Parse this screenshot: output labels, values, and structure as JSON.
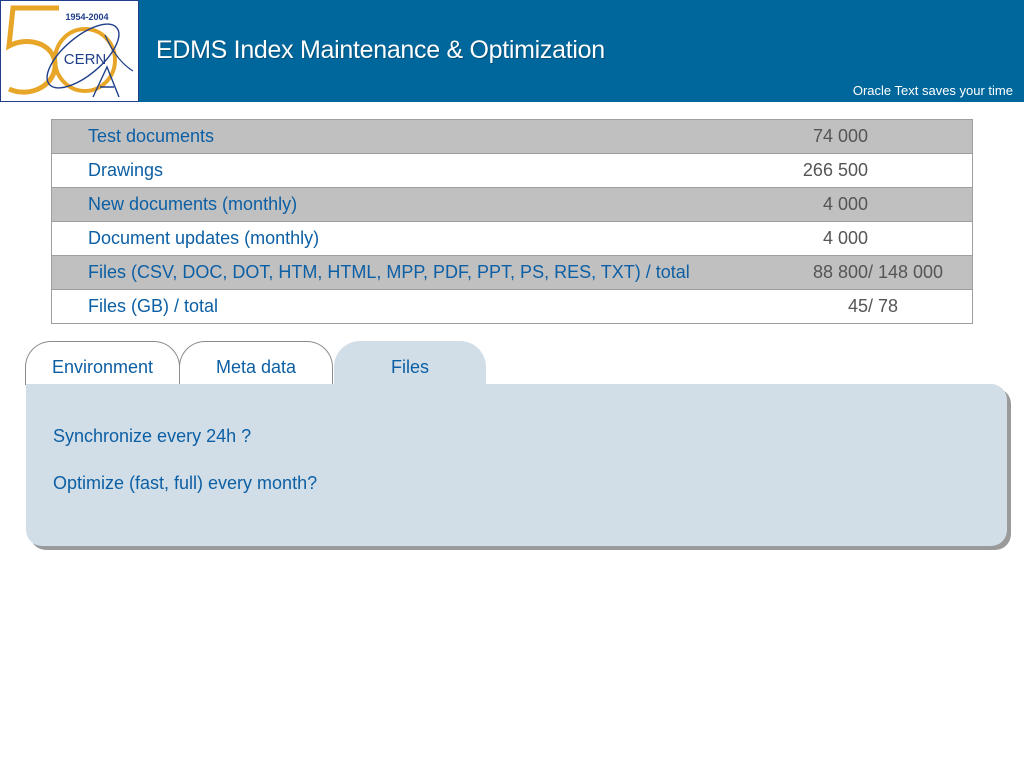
{
  "header": {
    "title": "EDMS Index Maintenance & Optimization",
    "tagline": "Oracle Text saves your time",
    "logo": {
      "years": "1954-2004",
      "anniversary": "50",
      "name": "CERN",
      "colors": {
        "digits": "#e8a628",
        "ring": "#1f3f8a"
      }
    },
    "colors": {
      "bar": "#00679c",
      "text": "#ffffff"
    }
  },
  "stats_table": {
    "rows": [
      {
        "label": "Test documents",
        "value": "74 000",
        "total": ""
      },
      {
        "label": "Drawings",
        "value": "266 500",
        "total": ""
      },
      {
        "label": "New documents (monthly)",
        "value": "4 000",
        "total": ""
      },
      {
        "label": "Document updates (monthly)",
        "value": "4 000",
        "total": ""
      },
      {
        "label": "Files (CSV, DOC, DOT, HTM, HTML, MPP, PDF, PPT, PS, RES, TXT) / total",
        "value": "88 800",
        "total": "/ 148 000"
      },
      {
        "label": "Files (GB) / total",
        "value": "45",
        "total": "/ 78"
      }
    ]
  },
  "tabs": {
    "items": [
      {
        "label": "Environment"
      },
      {
        "label": "Meta data"
      },
      {
        "label": "Files"
      }
    ],
    "active": "Files"
  },
  "panel": {
    "lines": [
      "Synchronize every 24h ?",
      "Optimize (fast, full) every month?"
    ]
  }
}
